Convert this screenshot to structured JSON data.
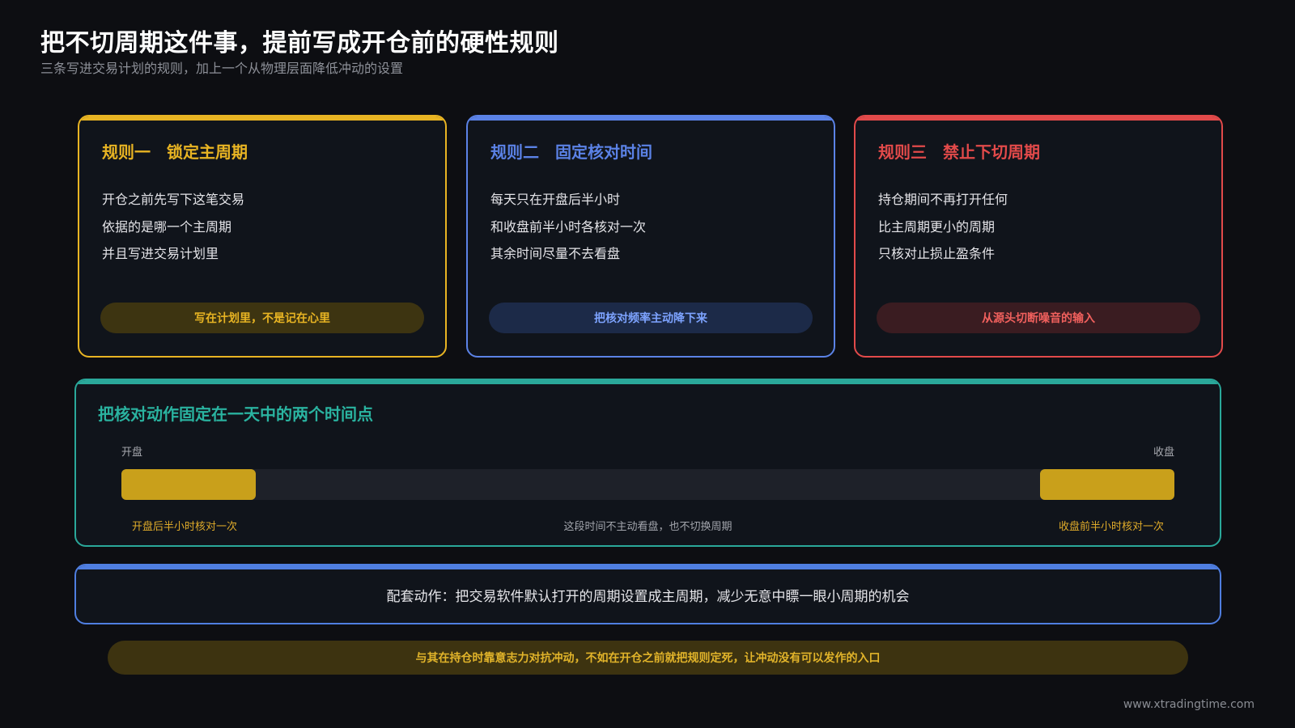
{
  "header": {
    "title": "把不切周期这件事，提前写成开仓前的硬性规则",
    "subtitle": "三条写进交易计划的规则，加上一个从物理层面降低冲动的设置"
  },
  "cards": [
    {
      "title": "规则一　锁定主周期",
      "lines": [
        "开仓之前先写下这笔交易",
        "依据的是哪一个主周期",
        "并且写进交易计划里"
      ],
      "pill": "写在计划里，不是记在心里",
      "accent": "#e8b423",
      "pill_bg": "#3d3411",
      "pill_text": "#e8b423"
    },
    {
      "title": "规则二　固定核对时间",
      "lines": [
        "每天只在开盘后半小时",
        "和收盘前半小时各核对一次",
        "其余时间尽量不去看盘"
      ],
      "pill": "把核对频率主动降下来",
      "accent": "#5b82e6",
      "pill_bg": "#1c2a48",
      "pill_text": "#7da3ff"
    },
    {
      "title": "规则三　禁止下切周期",
      "lines": [
        "持仓期间不再打开任何",
        "比主周期更小的周期",
        "只核对止损止盈条件"
      ],
      "pill": "从源头切断噪音的输入",
      "accent": "#e24a4a",
      "pill_bg": "#3a1c21",
      "pill_text": "#f0605d"
    }
  ],
  "timeline": {
    "title": "把核对动作固定在一天中的两个时间点",
    "start_label": "开盘",
    "end_label": "收盘",
    "left_caption": "开盘后半小时核对一次",
    "middle_caption": "这段时间不主动看盘，也不切换周期",
    "right_caption": "收盘前半小时核对一次",
    "accent": "#2aa89a",
    "segment_color": "#c9a01b"
  },
  "action": {
    "text": "配套动作：把交易软件默认打开的周期设置成主周期，减少无意中瞟一眼小周期的机会"
  },
  "bottom_banner": {
    "text": "与其在持仓时靠意志力对抗冲动，不如在开仓之前就把规则定死，让冲动没有可以发作的入口"
  },
  "footer": {
    "url": "www.xtradingtime.com"
  }
}
